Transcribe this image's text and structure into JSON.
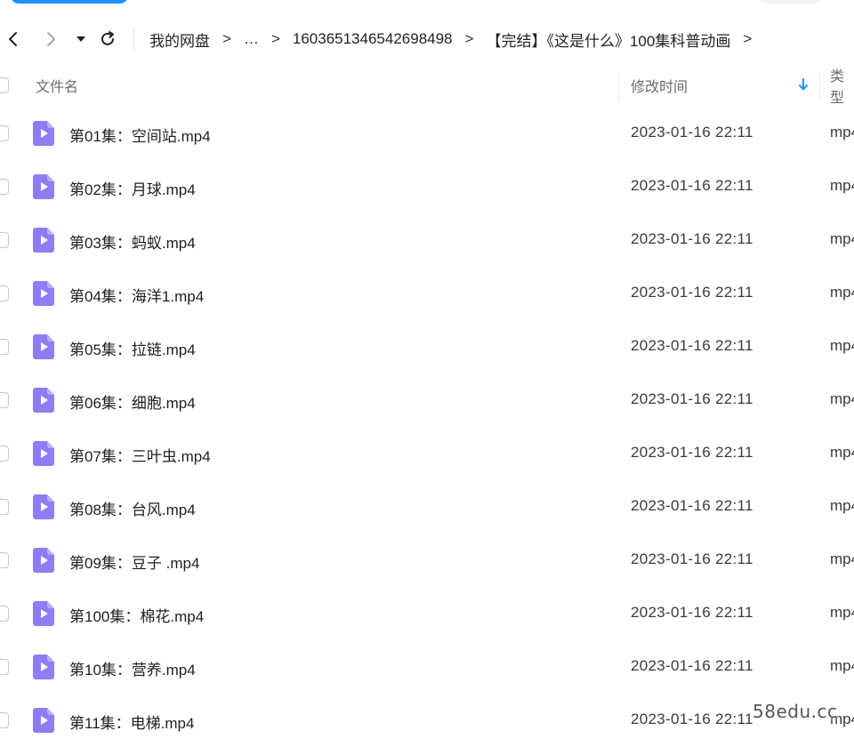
{
  "nav": {
    "breadcrumb": [
      "我的网盘",
      "…",
      "1603651346542698498",
      "【完结】《这是什么》100集科普动画"
    ],
    "separator": ">"
  },
  "header": {
    "name": "文件名",
    "modified": "修改时间",
    "type": "类型"
  },
  "files": [
    {
      "name": "第01集：空间站.mp4",
      "modified": "2023-01-16 22:11",
      "type": "mp4"
    },
    {
      "name": "第02集：月球.mp4",
      "modified": "2023-01-16 22:11",
      "type": "mp4"
    },
    {
      "name": "第03集：蚂蚁.mp4",
      "modified": "2023-01-16 22:11",
      "type": "mp4"
    },
    {
      "name": "第04集：海洋1.mp4",
      "modified": "2023-01-16 22:11",
      "type": "mp4"
    },
    {
      "name": "第05集：拉链.mp4",
      "modified": "2023-01-16 22:11",
      "type": "mp4"
    },
    {
      "name": "第06集：细胞.mp4",
      "modified": "2023-01-16 22:11",
      "type": "mp4"
    },
    {
      "name": "第07集：三叶虫.mp4",
      "modified": "2023-01-16 22:11",
      "type": "mp4"
    },
    {
      "name": "第08集：台风.mp4",
      "modified": "2023-01-16 22:11",
      "type": "mp4"
    },
    {
      "name": "第09集：豆子 .mp4",
      "modified": "2023-01-16 22:11",
      "type": "mp4"
    },
    {
      "name": "第100集：棉花.mp4",
      "modified": "2023-01-16 22:11",
      "type": "mp4"
    },
    {
      "name": "第10集：营养.mp4",
      "modified": "2023-01-16 22:11",
      "type": "mp4"
    },
    {
      "name": "第11集：电梯.mp4",
      "modified": "2023-01-16 22:11",
      "type": "mp4"
    }
  ],
  "watermark": "58edu.cc",
  "colors": {
    "accent": "#1e90ff",
    "video_icon": "#8f7cf6",
    "sort_arrow": "#1e90ff"
  },
  "icons": {
    "back": "chevron-left-icon",
    "forward": "chevron-right-icon",
    "dropdown": "caret-down-icon",
    "refresh": "refresh-icon",
    "sort": "arrow-down-icon",
    "file": "video-file-icon"
  }
}
